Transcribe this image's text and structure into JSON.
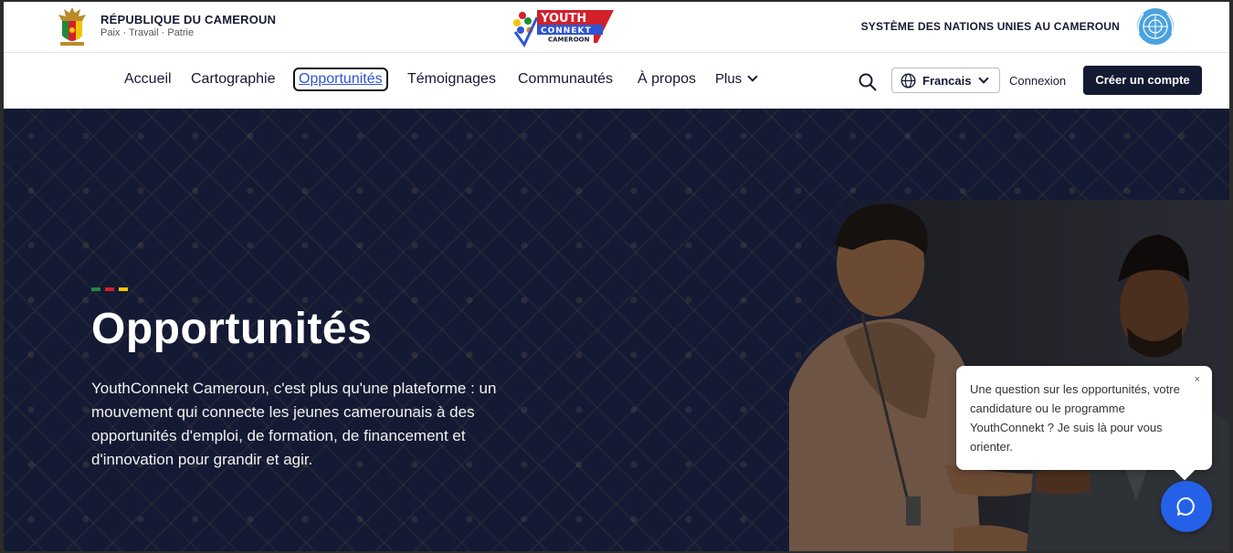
{
  "header": {
    "gov_title": "RÉPUBLIQUE DU CAMEROUN",
    "gov_motto": "Paix · Travail · Patrie",
    "logo_icon": "youthconnekt-cameroon-logo",
    "logo_text": {
      "line1": "YOUTH",
      "line2": "CONNEKT",
      "line3": "CAMEROON"
    },
    "un_text": "SYSTÈME DES NATIONS UNIES AU CAMEROUN",
    "un_icon": "un-emblem-icon"
  },
  "nav": {
    "items": [
      {
        "label": "Accueil"
      },
      {
        "label": "Cartographie"
      },
      {
        "label": "Opportunités",
        "active": true
      },
      {
        "label": "Témoignages"
      },
      {
        "label": "Communautés"
      },
      {
        "label": "À propos"
      },
      {
        "label": "Plus"
      }
    ],
    "language": "Francais",
    "login": "Connexion",
    "signup": "Créer un compte"
  },
  "hero": {
    "title": "Opportunités",
    "description": "YouthConnekt Cameroun, c'est plus qu'une plateforme : un mouvement qui connecte les jeunes camerounais à des opportunités d'emploi, de formation, de financement et d'innovation pour grandir et agir.",
    "accent_colors": [
      "#1f8a3b",
      "#d3202b",
      "#f2c500"
    ]
  },
  "chat": {
    "message": "Une question sur les opportunités, votre candidature ou le programme YouthConnekt ? Je suis là pour vous orienter.",
    "close": "×"
  },
  "colors": {
    "navy": "#151a33",
    "hero_bg": "#141a33",
    "active_link": "#2f55d4",
    "chat_button": "#2561e8"
  }
}
